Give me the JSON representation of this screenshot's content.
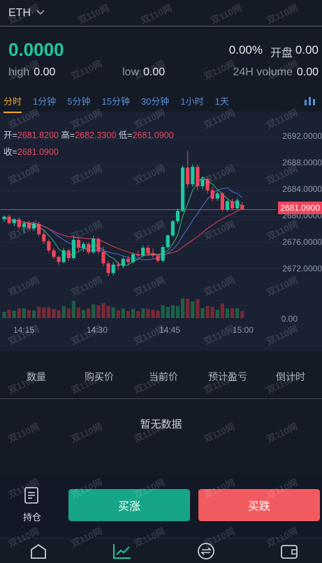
{
  "header": {
    "coin": "ETH",
    "dropdown_icon": "chevron-down-icon"
  },
  "ticker": {
    "price": "0.0000",
    "change_pct": "0.00%",
    "open_label": "开盘",
    "open_value": "0.00",
    "high_label": "high",
    "high_value": "0.00",
    "low_label": "low",
    "low_value": "0.00",
    "volume_label": "24H volume",
    "volume_value": "0.00"
  },
  "tabs": [
    "分时",
    "1分钟",
    "5分钟",
    "15分钟",
    "30分钟",
    "1小时",
    "1天"
  ],
  "active_tab": "分时",
  "ohlc": {
    "open_label": "开=",
    "open": "2681.8200",
    "high_label": "高=",
    "high": "2682.3300",
    "low_label": "低=",
    "low": "2681.0900",
    "close_label": "收=",
    "close": "2681.0900"
  },
  "chart_data": {
    "type": "candlestick",
    "y_ticks": [
      "2692.0000",
      "2688.0000",
      "2684.0000",
      "2680.0000",
      "2676.0000",
      "2672.0000",
      "0.00"
    ],
    "current_price_label": "2681.0900",
    "x_ticks": [
      "14:15",
      "14:30",
      "14:45",
      "15:00"
    ],
    "ylim": [
      2668,
      2693
    ],
    "candles": [
      [
        2679.6,
        2680.2,
        2679.2,
        2680.0
      ],
      [
        2680.0,
        2680.3,
        2678.8,
        2679.0
      ],
      [
        2679.0,
        2679.8,
        2678.5,
        2679.6
      ],
      [
        2679.6,
        2679.9,
        2678.1,
        2678.4
      ],
      [
        2678.4,
        2679.3,
        2677.5,
        2679.0
      ],
      [
        2679.0,
        2679.4,
        2678.0,
        2678.2
      ],
      [
        2678.2,
        2679.1,
        2677.8,
        2678.9
      ],
      [
        2678.9,
        2679.2,
        2677.0,
        2677.3
      ],
      [
        2677.3,
        2677.8,
        2675.8,
        2676.2
      ],
      [
        2676.2,
        2676.5,
        2674.4,
        2674.8
      ],
      [
        2674.8,
        2675.2,
        2673.5,
        2673.8
      ],
      [
        2673.8,
        2674.0,
        2672.6,
        2673.0
      ],
      [
        2673.0,
        2675.2,
        2672.8,
        2674.8
      ],
      [
        2674.8,
        2675.0,
        2673.2,
        2673.6
      ],
      [
        2673.6,
        2677.0,
        2673.4,
        2676.4
      ],
      [
        2676.4,
        2676.8,
        2674.8,
        2675.2
      ],
      [
        2675.2,
        2676.1,
        2674.6,
        2675.8
      ],
      [
        2675.8,
        2676.0,
        2674.2,
        2674.5
      ],
      [
        2674.5,
        2677.1,
        2674.3,
        2676.6
      ],
      [
        2676.6,
        2676.8,
        2674.2,
        2674.6
      ],
      [
        2674.6,
        2675.4,
        2672.3,
        2672.8
      ],
      [
        2672.8,
        2673.2,
        2670.8,
        2671.3
      ],
      [
        2671.3,
        2673.0,
        2670.9,
        2672.6
      ],
      [
        2672.6,
        2673.1,
        2671.8,
        2672.4
      ],
      [
        2672.4,
        2673.8,
        2672.0,
        2673.5
      ],
      [
        2673.5,
        2673.9,
        2672.7,
        2673.0
      ],
      [
        2673.0,
        2674.5,
        2672.8,
        2674.2
      ],
      [
        2674.2,
        2674.8,
        2673.6,
        2674.0
      ],
      [
        2674.0,
        2675.6,
        2673.8,
        2675.2
      ],
      [
        2675.2,
        2675.6,
        2673.9,
        2674.3
      ],
      [
        2674.3,
        2675.1,
        2673.6,
        2674.0
      ],
      [
        2674.0,
        2674.2,
        2672.9,
        2673.2
      ],
      [
        2673.2,
        2675.6,
        2673.0,
        2675.3
      ],
      [
        2675.3,
        2677.3,
        2675.1,
        2677.1
      ],
      [
        2677.1,
        2679.5,
        2676.9,
        2679.3
      ],
      [
        2679.3,
        2681.3,
        2678.9,
        2680.9
      ],
      [
        2680.9,
        2687.9,
        2680.7,
        2687.6
      ],
      [
        2687.6,
        2690.2,
        2684.5,
        2685.0
      ],
      [
        2685.0,
        2688.1,
        2684.6,
        2687.7
      ],
      [
        2687.7,
        2688.1,
        2684.1,
        2684.7
      ],
      [
        2684.7,
        2686.1,
        2684.2,
        2685.8
      ],
      [
        2685.8,
        2686.0,
        2683.6,
        2684.1
      ],
      [
        2684.1,
        2684.6,
        2682.4,
        2682.8
      ],
      [
        2682.8,
        2684.0,
        2682.5,
        2683.6
      ],
      [
        2683.6,
        2683.8,
        2680.8,
        2681.1
      ],
      [
        2681.1,
        2682.6,
        2680.8,
        2682.4
      ],
      [
        2682.4,
        2682.8,
        2681.0,
        2681.3
      ],
      [
        2681.3,
        2682.9,
        2681.1,
        2682.5
      ],
      [
        2681.8,
        2682.3,
        2681.1,
        2681.1
      ]
    ]
  },
  "positions": {
    "columns": [
      "数量",
      "购买价",
      "当前价",
      "预计盈亏",
      "倒计时"
    ],
    "empty_text": "暂无数据"
  },
  "actions": {
    "positions_label": "持仓",
    "buy_up": "买涨",
    "buy_down": "买跌"
  },
  "watermark": "双110网",
  "colors": {
    "up": "#1fc8a0",
    "down": "#f0445c",
    "accent": "#f5a623",
    "tab_blue": "#5a8fd6"
  }
}
